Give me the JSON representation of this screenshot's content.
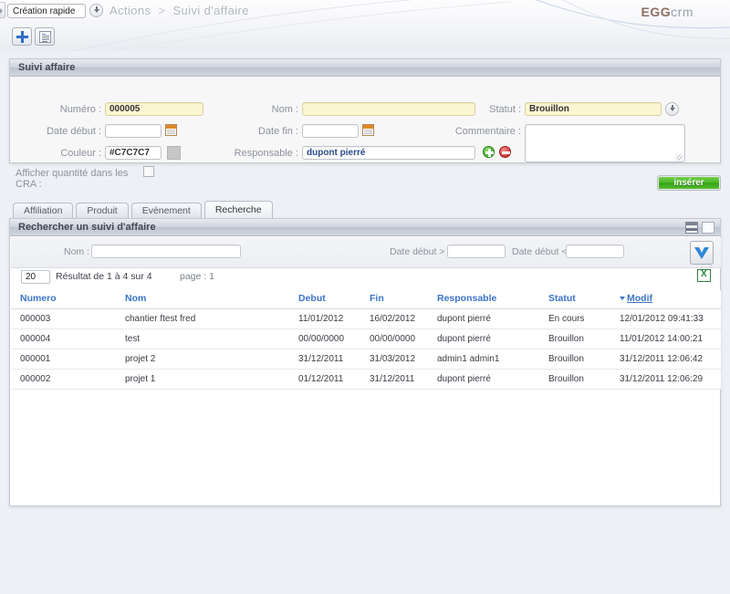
{
  "header": {
    "quick_create_value": "Création rapide",
    "breadcrumb_root": "Actions",
    "breadcrumb_sep": ">",
    "breadcrumb_current": "Suivi d'affaire",
    "logo_primary": "EGG",
    "logo_secondary": "crm"
  },
  "form": {
    "title": "Suivi affaire",
    "numero_label": "Numéro :",
    "numero_value": "000005",
    "nom_label": "Nom :",
    "nom_value": "",
    "statut_label": "Statut :",
    "statut_value": "Brouillon",
    "date_debut_label": "Date début :",
    "date_debut_value": "",
    "date_fin_label": "Date fin :",
    "date_fin_value": "",
    "commentaire_label": "Commentaire :",
    "commentaire_value": "",
    "couleur_label": "Couleur :",
    "couleur_value": "#C7C7C7",
    "couleur_swatch": "#C7C7C7",
    "responsable_label": "Responsable :",
    "responsable_value": "dupont pierré",
    "cra_label": "Afficher quantité dans les CRA :",
    "insert_label": "insérer"
  },
  "tabs": [
    {
      "label": "Affiliation",
      "active": false
    },
    {
      "label": "Produit",
      "active": false
    },
    {
      "label": "Evènement",
      "active": false
    },
    {
      "label": "Recherche",
      "active": true
    }
  ],
  "search": {
    "title": "Rechercher un suivi d'affaire",
    "nom_label": "Nom :",
    "nom_value": "",
    "date_debut_sup_label": "Date début >",
    "date_debut_sup_value": "",
    "date_debut_inf_label": "Date début <",
    "date_debut_inf_value": "",
    "page_size": "20",
    "result_text": "Résultat de 1 à 4 sur 4",
    "page_text": "page : 1"
  },
  "table": {
    "columns": [
      "Numero",
      "Nom",
      "Debut",
      "Fin",
      "Responsable",
      "Statut",
      "Modif"
    ],
    "sorted_column": "Modif",
    "rows": [
      {
        "numero": "000003",
        "nom": "chantier ftest fred",
        "debut": "11/01/2012",
        "fin": "16/02/2012",
        "responsable": "dupont pierré",
        "statut": "En cours",
        "modif": "12/01/2012 09:41:33"
      },
      {
        "numero": "000004",
        "nom": "test",
        "debut": "00/00/0000",
        "fin": "00/00/0000",
        "responsable": "dupont pierré",
        "statut": "Brouillon",
        "modif": "11/01/2012 14:00:21"
      },
      {
        "numero": "000001",
        "nom": "projet 2",
        "debut": "31/12/2011",
        "fin": "31/03/2012",
        "responsable": "admin1 admin1",
        "statut": "Brouillon",
        "modif": "31/12/2011 12:06:42"
      },
      {
        "numero": "000002",
        "nom": "projet 1",
        "debut": "01/12/2011",
        "fin": "31/12/2011",
        "responsable": "dupont pierré",
        "statut": "Brouillon",
        "modif": "31/12/2011 12:06:29"
      }
    ]
  },
  "colors": {
    "accent_blue": "#3a74c8",
    "insert_green": "#46b524",
    "field_yellow": "#fcf6d3",
    "logo_brown": "#8e6f63"
  }
}
